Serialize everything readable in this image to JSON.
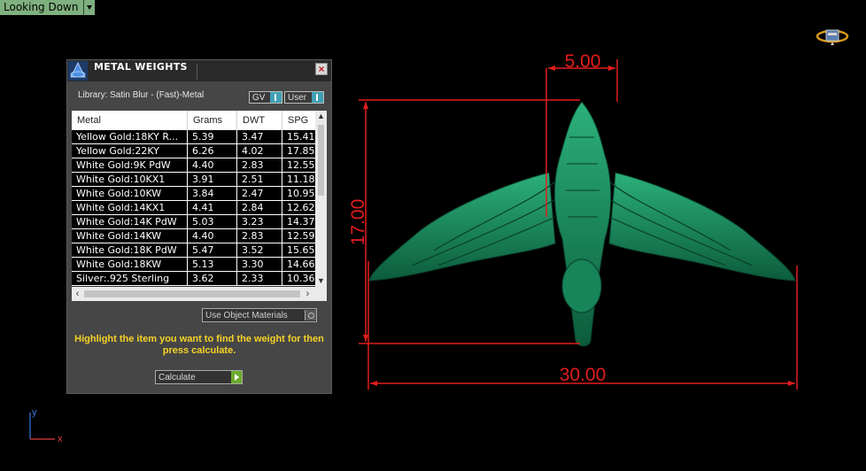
{
  "viewport": {
    "view_name": "Looking Down",
    "dimensions": {
      "top_width": "5.00",
      "height": "17.00",
      "bottom_width": "30.00"
    },
    "axis_x": "x",
    "axis_y": "y",
    "model_color": "#1a8a5c",
    "dimension_color": "#e31d1d"
  },
  "panel": {
    "title": "METAL WEIGHTS",
    "close_label": "×",
    "library": "Library: Satin Blur - (Fast)-Metal",
    "gv_label": "GV",
    "user_label": "User",
    "columns": [
      "Metal",
      "Grams",
      "DWT",
      "SPG"
    ],
    "rows": [
      [
        "Yellow Gold:18KY R...",
        "5.39",
        "3.47",
        "15.41"
      ],
      [
        "Yellow Gold:22KY",
        "6.26",
        "4.02",
        "17.85"
      ],
      [
        "White Gold:9K PdW",
        "4.40",
        "2.83",
        "12.55"
      ],
      [
        "White Gold:10KX1",
        "3.91",
        "2.51",
        "11.18"
      ],
      [
        "White Gold:10KW",
        "3.84",
        "2.47",
        "10.95"
      ],
      [
        "White Gold:14KX1",
        "4.41",
        "2.84",
        "12.62"
      ],
      [
        "White Gold:14K PdW",
        "5.03",
        "3.23",
        "14.37"
      ],
      [
        "White Gold:14KW",
        "4.40",
        "2.83",
        "12.59"
      ],
      [
        "White Gold:18K PdW",
        "5.47",
        "3.52",
        "15.65"
      ],
      [
        "White Gold:18KW",
        "5.13",
        "3.30",
        "14.66"
      ],
      [
        "Silver:.925 Sterling",
        "3.62",
        "2.33",
        "10.36"
      ]
    ],
    "use_object_materials": "Use Object Materials",
    "hint": "Highlight the item you want to find the weight for then press calculate.",
    "calculate_label": "Calculate"
  }
}
